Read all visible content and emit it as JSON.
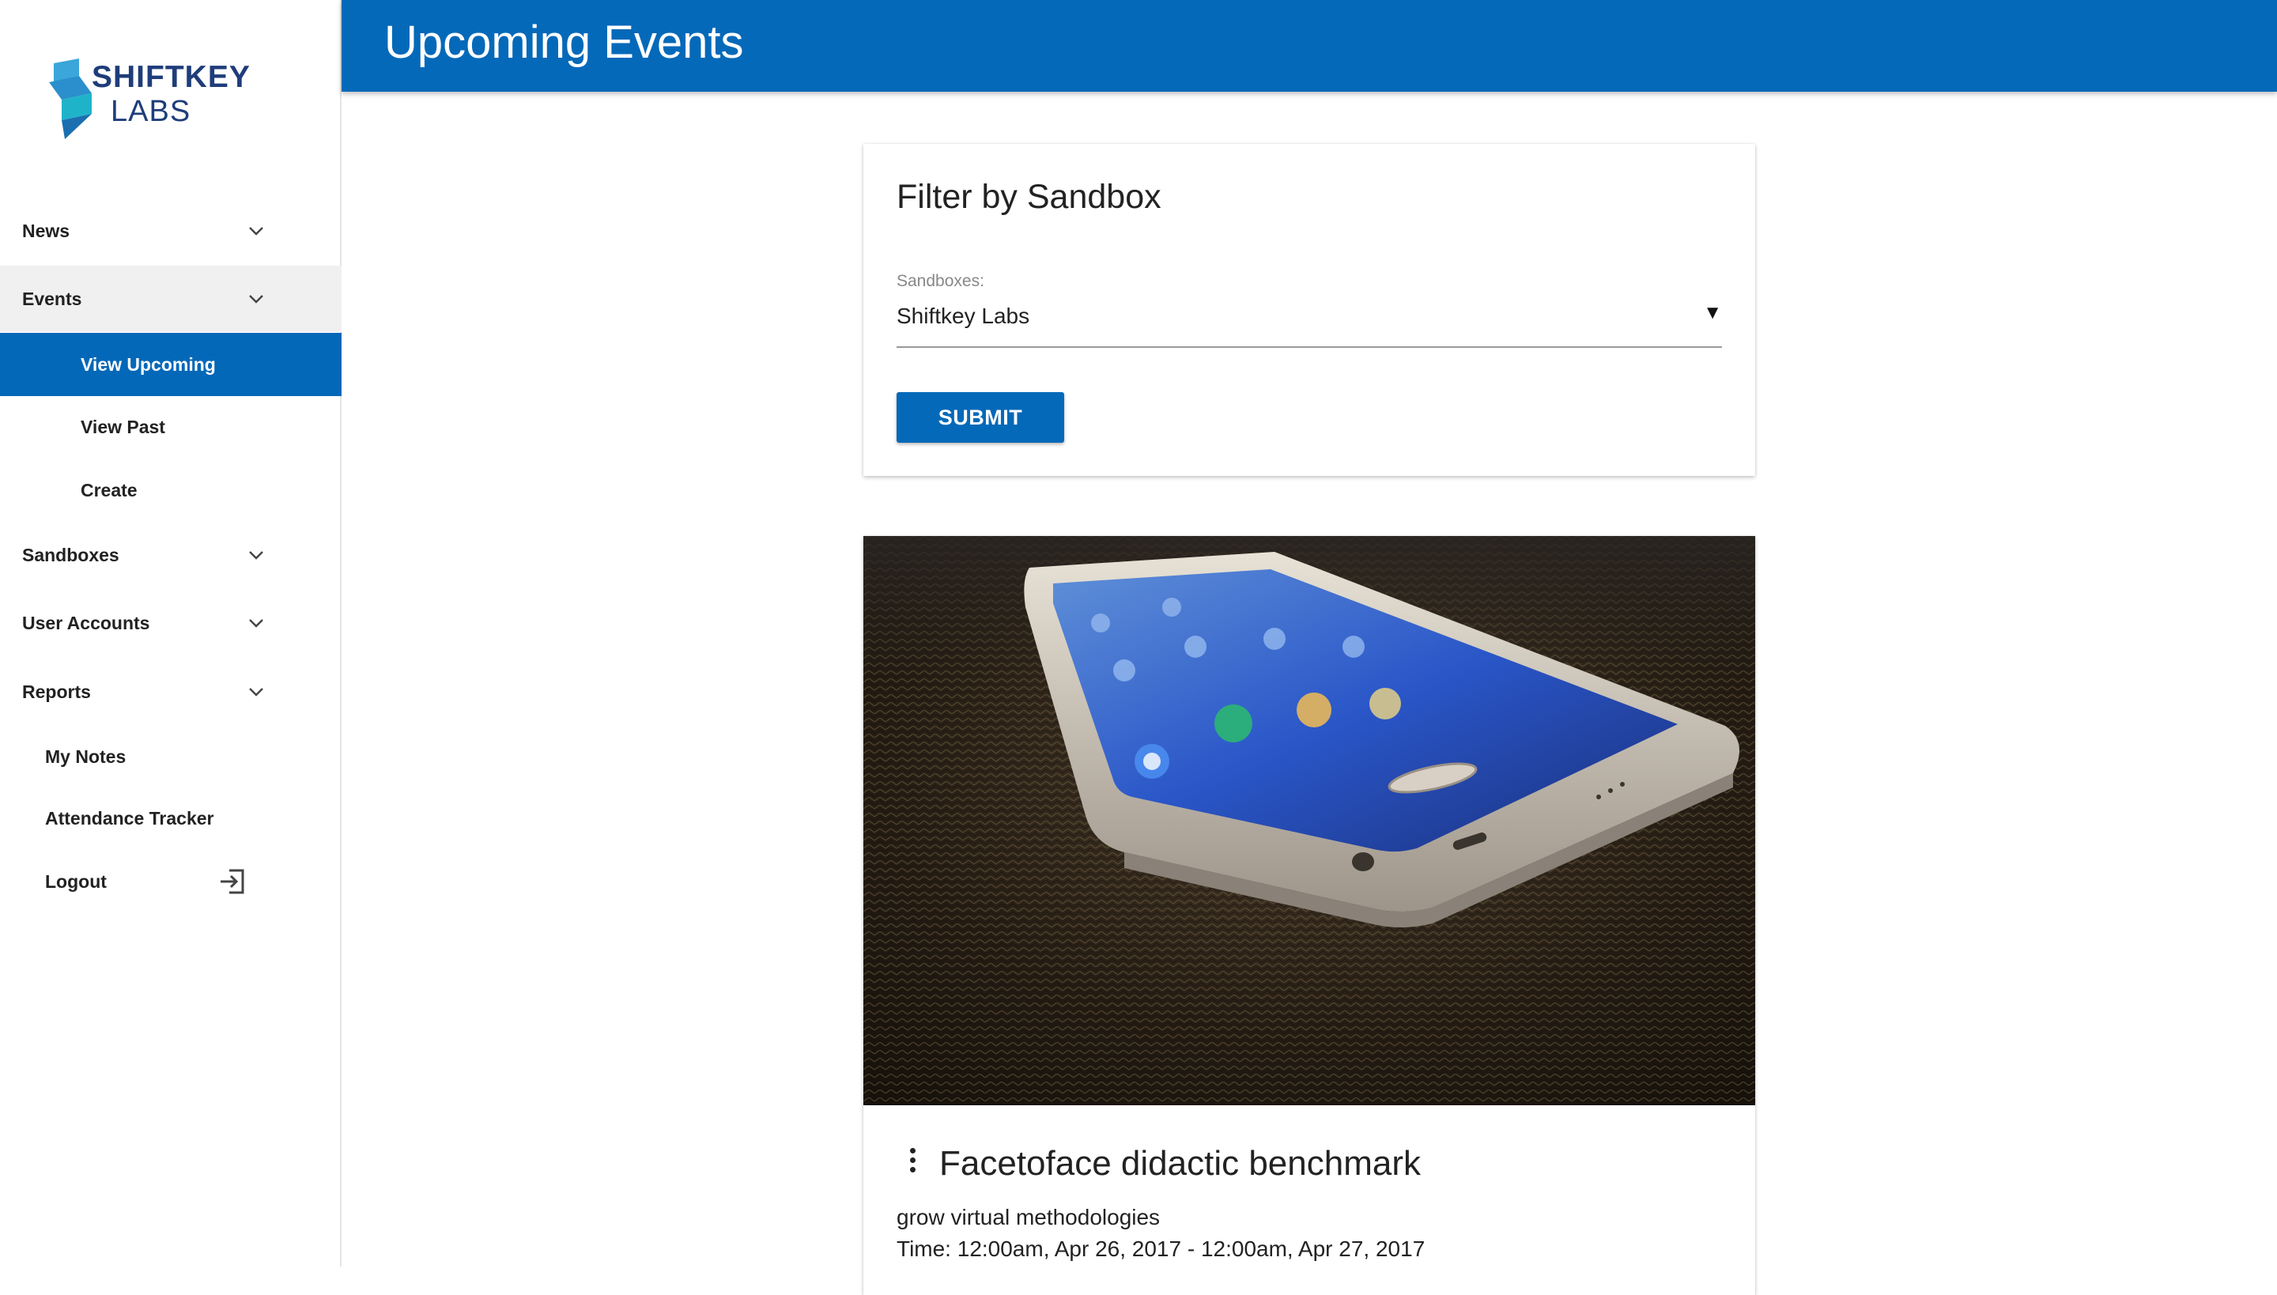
{
  "app": {
    "logo_line1": "SHIFTKEY",
    "logo_line2": "LABS",
    "brand_color": "#0569b9"
  },
  "sidebar": {
    "items": [
      {
        "label": "News",
        "icon": "chevron-down-icon"
      },
      {
        "label": "Events",
        "icon": "chevron-down-icon",
        "expanded": true
      },
      {
        "label": "View Upcoming",
        "active": true
      },
      {
        "label": "View Past"
      },
      {
        "label": "Create"
      },
      {
        "label": "Sandboxes",
        "icon": "chevron-down-icon"
      },
      {
        "label": "User Accounts",
        "icon": "chevron-down-icon"
      },
      {
        "label": "Reports",
        "icon": "chevron-down-icon"
      },
      {
        "label": "My Notes"
      },
      {
        "label": "Attendance Tracker"
      },
      {
        "label": "Logout",
        "icon": "logout-icon"
      }
    ]
  },
  "header": {
    "title": "Upcoming Events"
  },
  "filter": {
    "title": "Filter by Sandbox",
    "label": "Sandboxes:",
    "selected": "Shiftkey Labs",
    "arrow": "▼",
    "submit_label": "SUBMIT"
  },
  "event": {
    "image": "smartphone-photo",
    "title": "Facetoface didactic benchmark",
    "description": "grow virtual methodologies",
    "time": "Time: 12:00am, Apr 26, 2017 - 12:00am, Apr 27, 2017"
  }
}
